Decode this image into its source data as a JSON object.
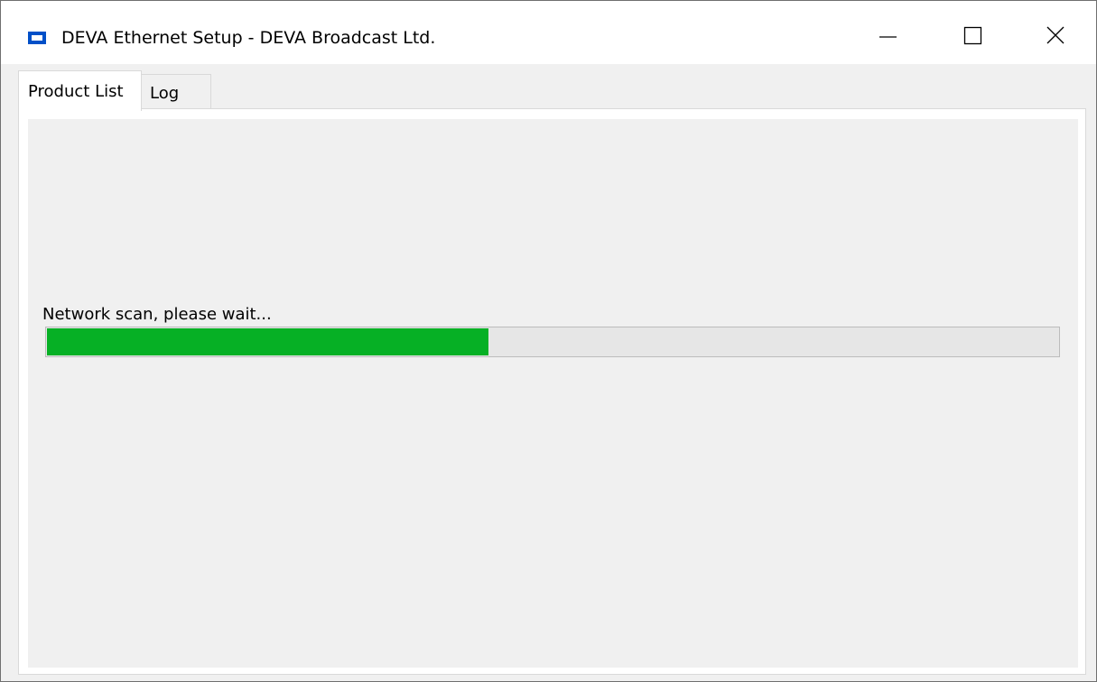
{
  "window": {
    "title": "DEVA Ethernet Setup - DEVA Broadcast Ltd.",
    "icon": "app-window-icon",
    "controls": [
      "minimize-icon",
      "maximize-icon",
      "close-icon"
    ]
  },
  "tabs": [
    {
      "label": "Product List",
      "active": true
    },
    {
      "label": "Log",
      "active": false
    }
  ],
  "scan": {
    "status_text": "Network scan, please wait...",
    "progress_fraction": 0.437,
    "progress_color": "#06b025"
  },
  "colors": {
    "accent": "#0050c8",
    "progress": "#06b025"
  }
}
